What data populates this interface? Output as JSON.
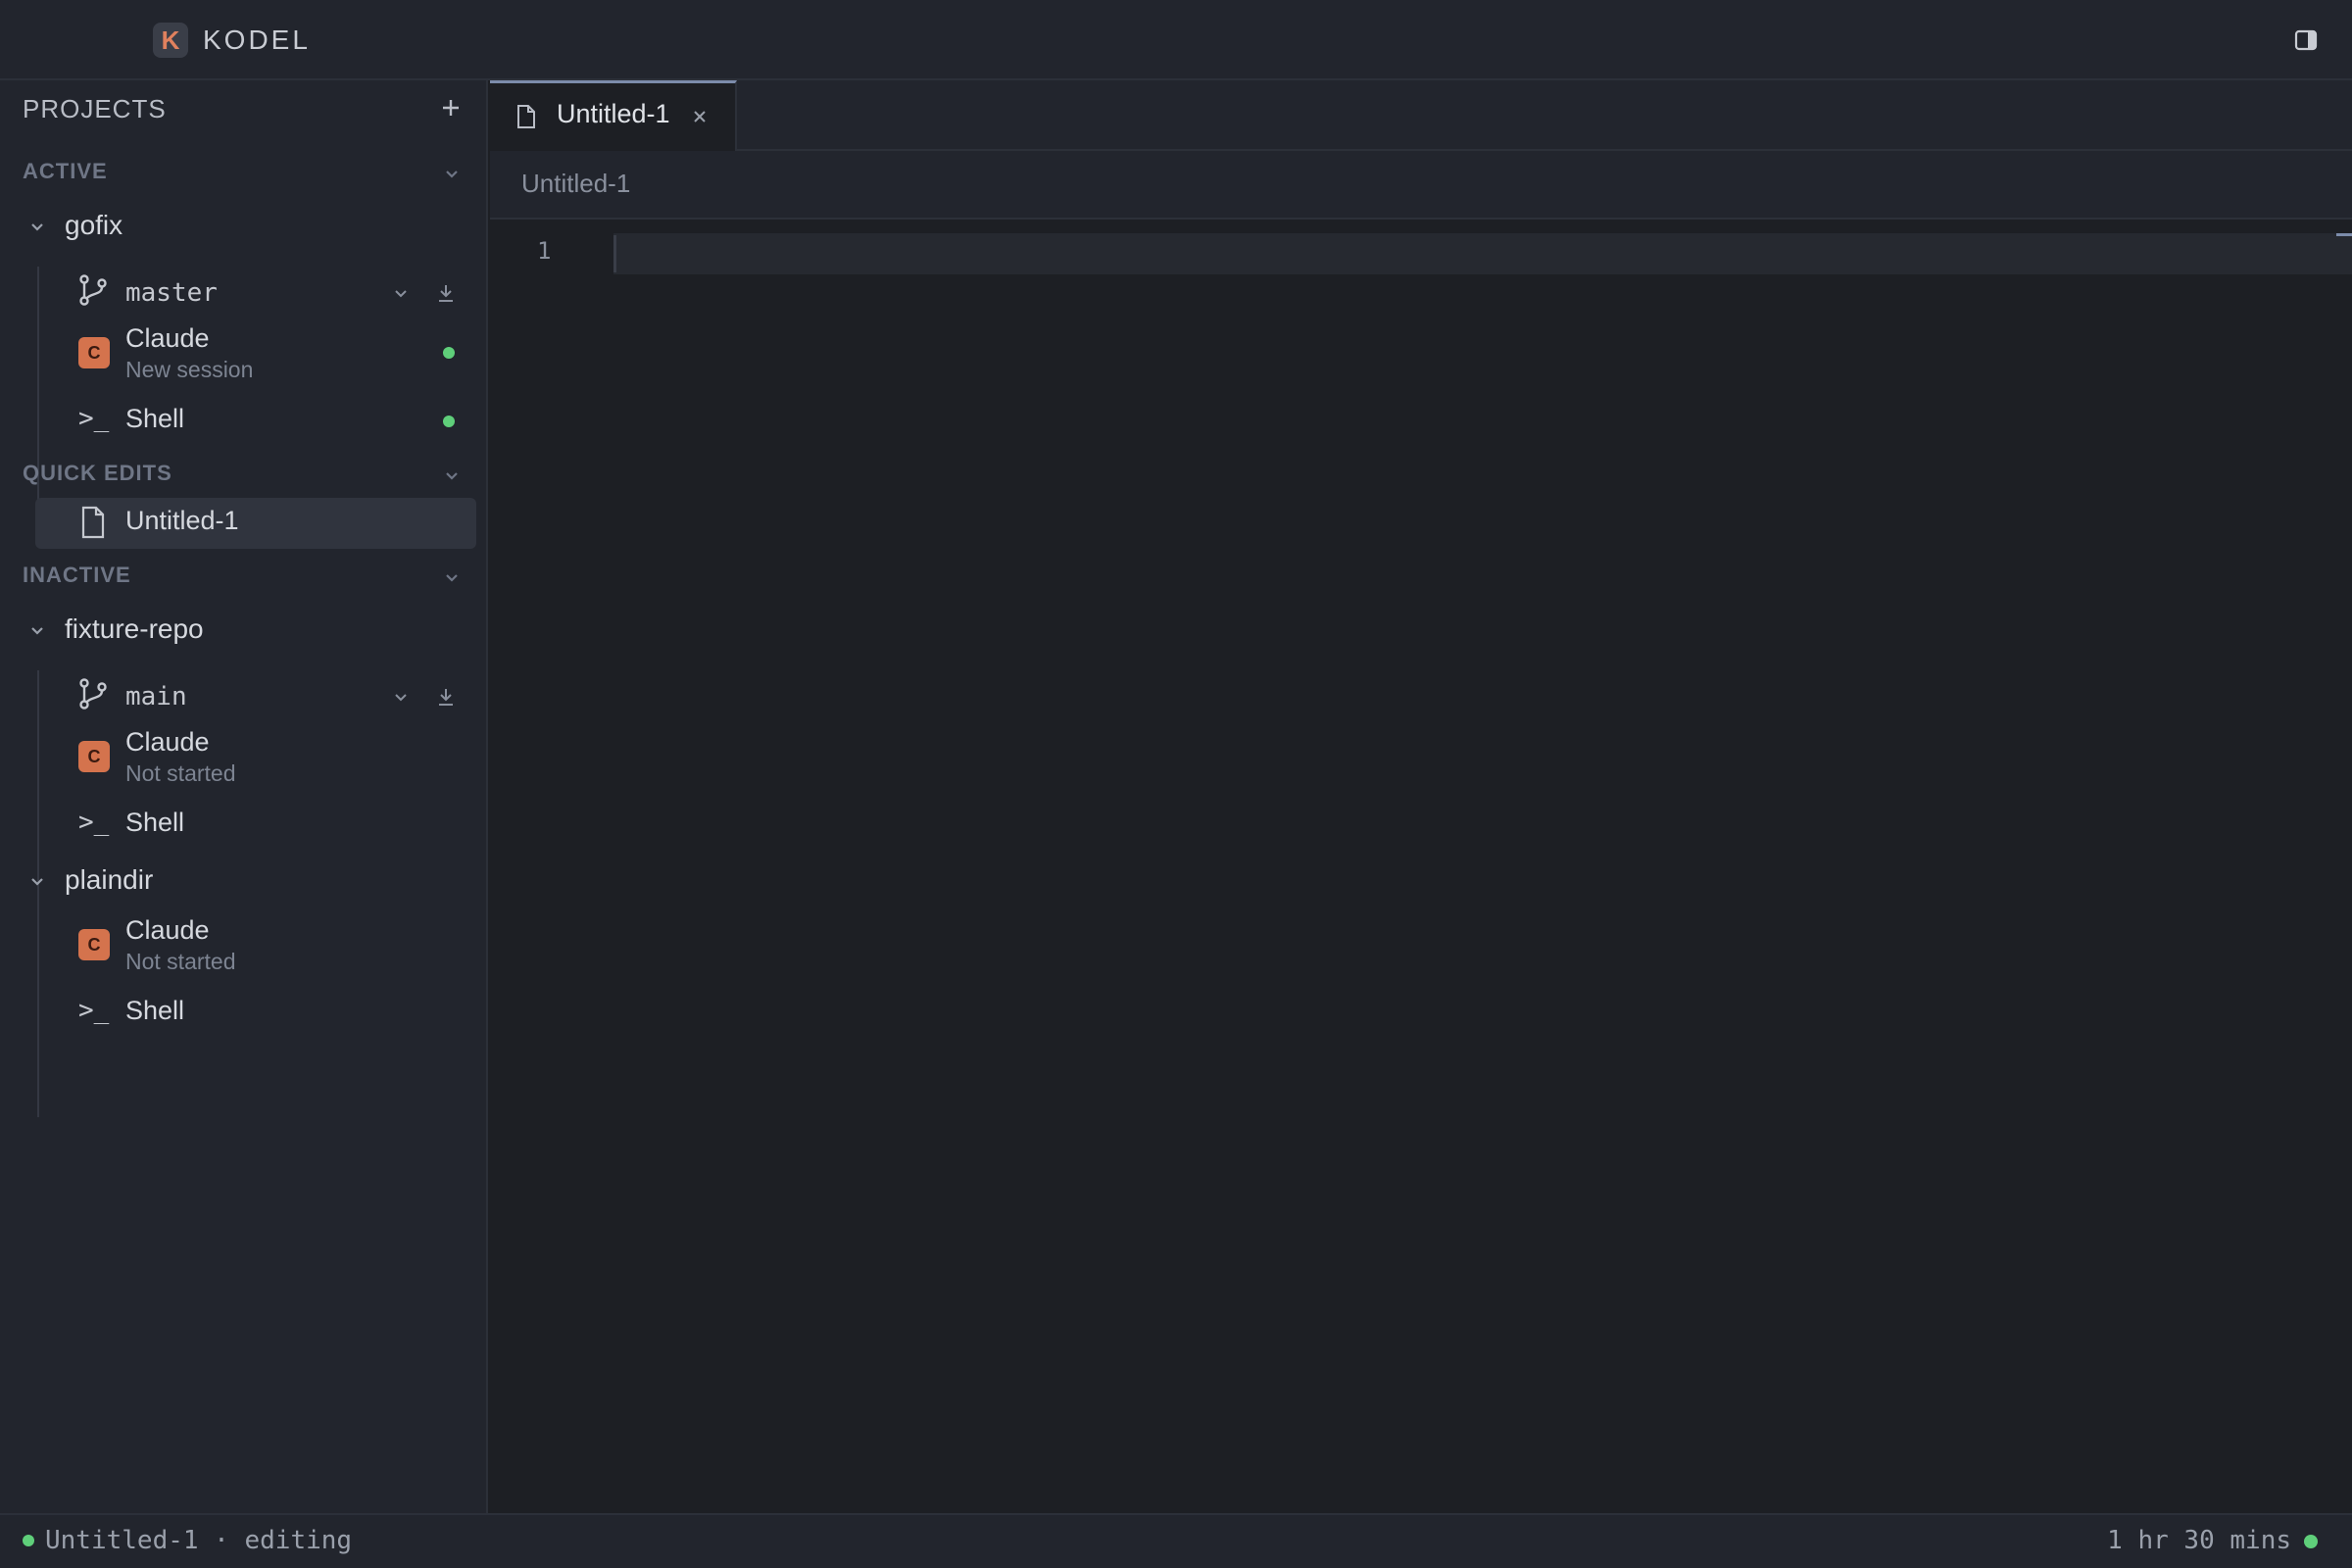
{
  "app": {
    "logo_letter": "K",
    "name": "KODEL"
  },
  "colors": {
    "accent": "#7c8cab",
    "claude": "#d4734d",
    "status_green": "#5fcf7a"
  },
  "sidebar": {
    "title": "PROJECTS",
    "sections": {
      "active": "ACTIVE",
      "quick_edits": "QUICK EDITS",
      "inactive": "INACTIVE"
    },
    "projects": {
      "gofix": {
        "name": "gofix",
        "branch": "master",
        "claude_badge": "C",
        "claude_label": "Claude",
        "claude_status": "New session",
        "shell_glyph": ">_",
        "shell_label": "Shell"
      },
      "fixture_repo": {
        "name": "fixture-repo",
        "branch": "main",
        "claude_badge": "C",
        "claude_label": "Claude",
        "claude_status": "Not started",
        "shell_glyph": ">_",
        "shell_label": "Shell"
      },
      "plaindir": {
        "name": "plaindir",
        "claude_badge": "C",
        "claude_label": "Claude",
        "claude_status": "Not started",
        "shell_glyph": ">_",
        "shell_label": "Shell"
      }
    },
    "quick_edit_file": "Untitled-1"
  },
  "tabs": [
    {
      "label": "Untitled-1",
      "active": true
    }
  ],
  "breadcrumb": "Untitled-1",
  "editor": {
    "line_number": "1"
  },
  "statusbar": {
    "left": "Untitled-1 · editing",
    "right": "1 hr 30 mins"
  }
}
